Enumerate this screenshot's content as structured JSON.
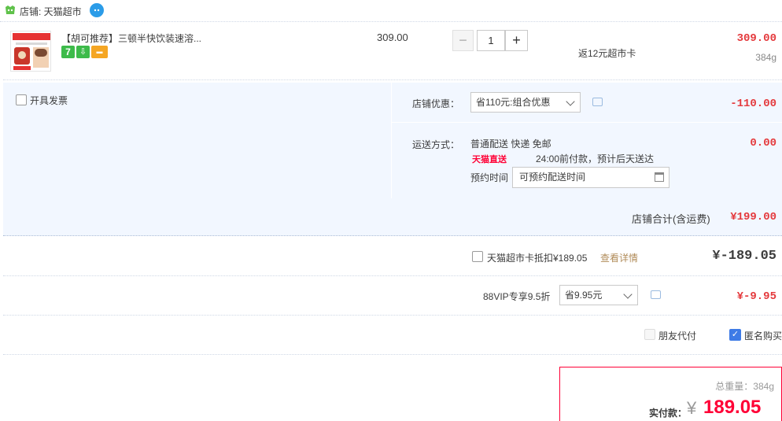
{
  "shop": {
    "label": "店铺: 天猫超市",
    "icon": "shop-icon",
    "chat_icon": "wangwang-chat-icon"
  },
  "item": {
    "title": "【胡可推荐】三顿半快饮装速溶...",
    "unit_price": "309.00",
    "quantity": "1",
    "qty_minus": "−",
    "qty_plus": "+",
    "rebate": "返12元超市卡",
    "line_total": "309.00",
    "weight": "384g",
    "badges": [
      "7",
      "⇩",
      "▬"
    ],
    "badge_colors": [
      "#3dbb4a",
      "#3dbb4a",
      "#f5a623"
    ]
  },
  "invoice": {
    "label": "开具发票"
  },
  "promo": {
    "label": "店铺优惠：",
    "selected": "省110元:组合优惠",
    "amount": "-110.00"
  },
  "shipping": {
    "label": "运送方式：",
    "method": "普通配送 快递 免邮",
    "direct_logo": "天猫直送",
    "direct_text": "24:00前付款，预计后天送达",
    "appointment_label": "预约时间",
    "appointment_value": "可预约配送时间",
    "amount": "0.00"
  },
  "shop_total": {
    "label": "店铺合计(含运费)",
    "value": "¥199.00"
  },
  "supermarket_card": {
    "label": "天猫超市卡抵扣¥189.05",
    "link": "查看详情",
    "amount": "¥-189.05"
  },
  "vip": {
    "label": "88VIP专享9.5折",
    "selected": "省9.95元",
    "amount": "¥-9.95"
  },
  "options": {
    "friend_pay": "朋友代付",
    "anonymous": "匿名购买",
    "anonymous_checked": "✓"
  },
  "summary": {
    "weight": "总重量：384g",
    "pay_label": "实付款：",
    "yen": "¥",
    "pay_value": "189.05"
  },
  "colors": {
    "accent_red": "#ff0036",
    "price_red": "#e4393c",
    "panel_bg": "#f2f7ff",
    "checkbox_blue": "#3e7be6"
  }
}
